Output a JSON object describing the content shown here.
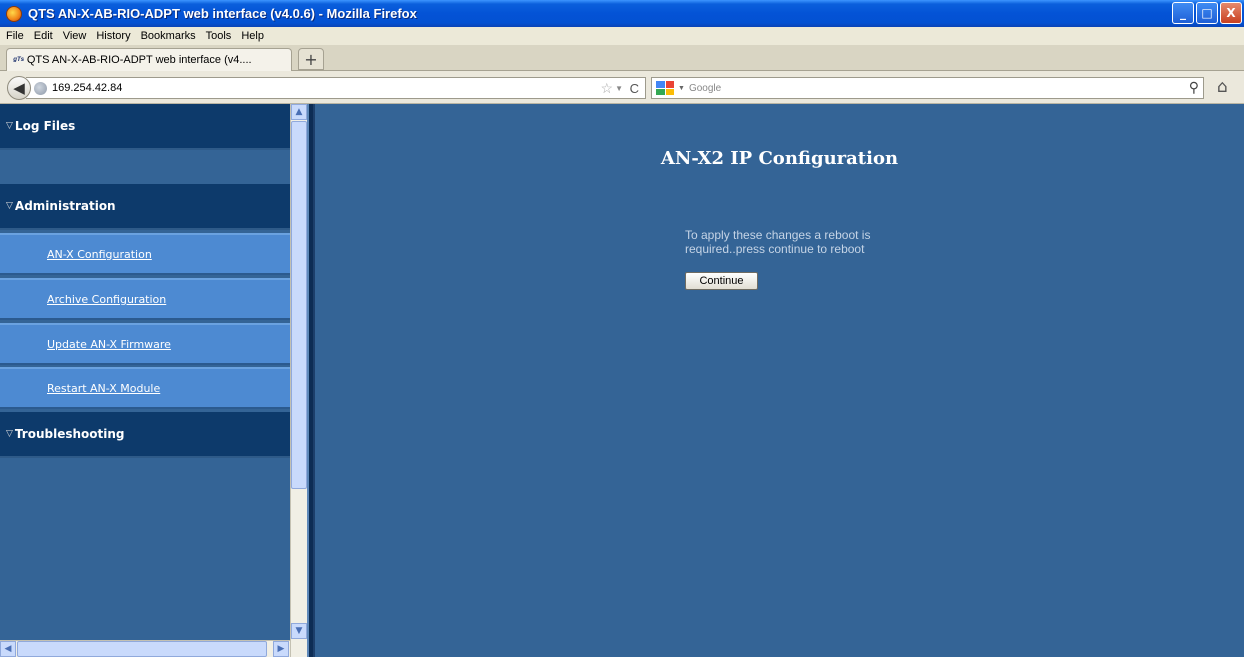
{
  "window": {
    "title": "QTS AN-X-AB-RIO-ADPT web interface (v4.0.6) - Mozilla Firefox",
    "minimize": "_",
    "maximize": "□",
    "close": "X"
  },
  "menubar": {
    "items": [
      "File",
      "Edit",
      "View",
      "History",
      "Bookmarks",
      "Tools",
      "Help"
    ]
  },
  "tabs": [
    {
      "favicon": "qts",
      "label": "QTS AN-X-AB-RIO-ADPT web interface (v4...."
    }
  ],
  "tabbar": {
    "new_tab": "+"
  },
  "navbar": {
    "url": "169.254.42.84",
    "search_placeholder": "Google"
  },
  "sidebar": {
    "sections": [
      {
        "label": "Log Files"
      },
      {
        "label": "Administration"
      },
      {
        "label": "Troubleshooting"
      }
    ],
    "items": [
      {
        "label": "AN-X Configuration"
      },
      {
        "label": "Archive Configuration"
      },
      {
        "label": "Update AN-X Firmware"
      },
      {
        "label": "Restart AN-X Module"
      }
    ]
  },
  "main": {
    "title": "AN-X2 IP Configuration",
    "message_line1": "To apply these changes a reboot is",
    "message_line2": "required..press continue to reboot",
    "continue_label": "Continue"
  },
  "colors": {
    "background": "#346496",
    "section_header": "#0d3a6b",
    "nav_item": "#4d8ad2"
  }
}
